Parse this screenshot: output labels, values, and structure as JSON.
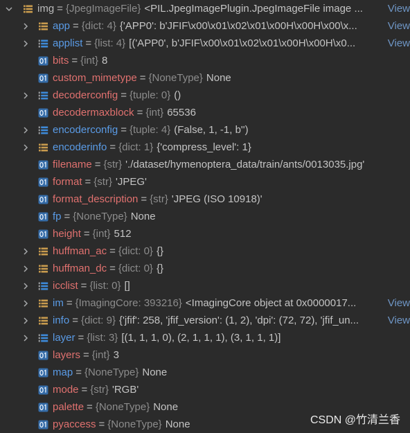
{
  "separator": "=",
  "colors": {
    "background": "#2b2b2b",
    "value": "#c4c4c4",
    "type": "#8c8c8c",
    "link": "#6e95c4",
    "separator": "#bbbbbb"
  },
  "variable": {
    "name": "img",
    "type": "{JpegImageFile}",
    "value": "<PIL.JpegImagePlugin.JpegImageFile image ...",
    "link": "View",
    "icon": "object-icon",
    "expanded": true,
    "name_color": "#bbbbbb",
    "children": [
      {
        "name": "app",
        "type": "{dict: 4}",
        "value": "{'APP0': b'JFIF\\x00\\x01\\x02\\x01\\x00H\\x00H\\x00\\x...",
        "link": "View",
        "icon": "dict-icon",
        "expandable": true,
        "name_color": "#5a9be6"
      },
      {
        "name": "applist",
        "type": "{list: 4}",
        "value": "[('APP0', b'JFIF\\x00\\x01\\x02\\x01\\x00H\\x00H\\x0...",
        "link": "View",
        "icon": "list-icon",
        "expandable": true,
        "name_color": "#5a9be6"
      },
      {
        "name": "bits",
        "type": "{int}",
        "value": "8",
        "icon": "primitive-icon",
        "name_color": "#e0716f"
      },
      {
        "name": "custom_mimetype",
        "type": "{NoneType}",
        "value": "None",
        "icon": "primitive-icon",
        "name_color": "#e0716f"
      },
      {
        "name": "decoderconfig",
        "type": "{tuple: 0}",
        "value": "()",
        "icon": "list-icon",
        "expandable": true,
        "name_color": "#e0716f"
      },
      {
        "name": "decodermaxblock",
        "type": "{int}",
        "value": "65536",
        "icon": "primitive-icon",
        "name_color": "#e0716f"
      },
      {
        "name": "encoderconfig",
        "type": "{tuple: 4}",
        "value": "(False, 1, -1, b'')",
        "icon": "list-icon",
        "expandable": true,
        "name_color": "#5a9be6"
      },
      {
        "name": "encoderinfo",
        "type": "{dict: 1}",
        "value": "{'compress_level': 1}",
        "icon": "dict-icon",
        "expandable": true,
        "name_color": "#5a9be6"
      },
      {
        "name": "filename",
        "type": "{str}",
        "value": "'./dataset/hymenoptera_data/train/ants/0013035.jpg'",
        "icon": "primitive-icon",
        "name_color": "#e0716f"
      },
      {
        "name": "format",
        "type": "{str}",
        "value": "'JPEG'",
        "icon": "primitive-icon",
        "name_color": "#e0716f"
      },
      {
        "name": "format_description",
        "type": "{str}",
        "value": "'JPEG (ISO 10918)'",
        "icon": "primitive-icon",
        "name_color": "#e0716f"
      },
      {
        "name": "fp",
        "type": "{NoneType}",
        "value": "None",
        "icon": "primitive-icon",
        "name_color": "#5a9be6"
      },
      {
        "name": "height",
        "type": "{int}",
        "value": "512",
        "icon": "primitive-icon",
        "name_color": "#e0716f"
      },
      {
        "name": "huffman_ac",
        "type": "{dict: 0}",
        "value": "{}",
        "icon": "dict-icon",
        "expandable": true,
        "name_color": "#e0716f"
      },
      {
        "name": "huffman_dc",
        "type": "{dict: 0}",
        "value": "{}",
        "icon": "dict-icon",
        "expandable": true,
        "name_color": "#e0716f"
      },
      {
        "name": "icclist",
        "type": "{list: 0}",
        "value": "[]",
        "icon": "list-icon",
        "expandable": true,
        "name_color": "#e0716f"
      },
      {
        "name": "im",
        "type": "{ImagingCore: 393216}",
        "value": "<ImagingCore object at 0x0000017...",
        "link": "View",
        "icon": "object-icon",
        "expandable": true,
        "name_color": "#5a9be6"
      },
      {
        "name": "info",
        "type": "{dict: 9}",
        "value": "{'jfif': 258, 'jfif_version': (1, 2), 'dpi': (72, 72), 'jfif_un...",
        "link": "View",
        "icon": "dict-icon",
        "expandable": true,
        "name_color": "#5a9be6"
      },
      {
        "name": "layer",
        "type": "{list: 3}",
        "value": "[(1, 1, 1, 0), (2, 1, 1, 1), (3, 1, 1, 1)]",
        "icon": "list-icon",
        "expandable": true,
        "name_color": "#5a9be6"
      },
      {
        "name": "layers",
        "type": "{int}",
        "value": "3",
        "icon": "primitive-icon",
        "name_color": "#e0716f"
      },
      {
        "name": "map",
        "type": "{NoneType}",
        "value": "None",
        "icon": "primitive-icon",
        "name_color": "#5a9be6"
      },
      {
        "name": "mode",
        "type": "{str}",
        "value": "'RGB'",
        "icon": "primitive-icon",
        "name_color": "#e0716f"
      },
      {
        "name": "palette",
        "type": "{NoneType}",
        "value": "None",
        "icon": "primitive-icon",
        "name_color": "#e0716f"
      },
      {
        "name": "pyaccess",
        "type": "{NoneType}",
        "value": "None",
        "icon": "primitive-icon",
        "name_color": "#e0716f"
      }
    ]
  },
  "watermark": "CSDN @竹清兰香"
}
